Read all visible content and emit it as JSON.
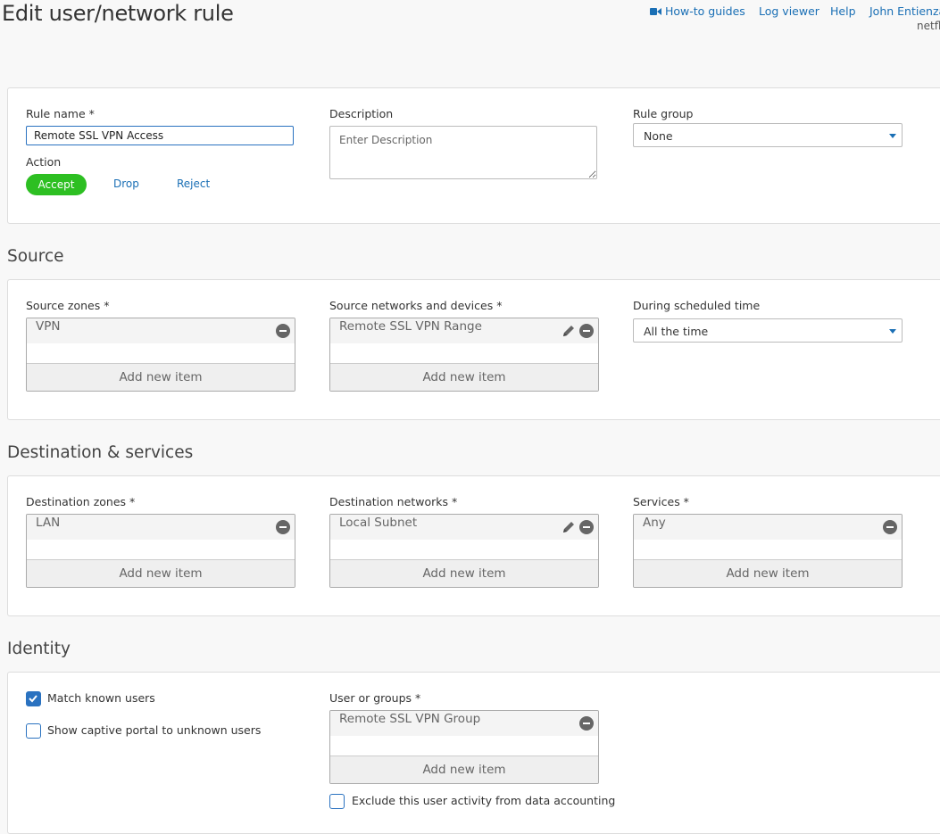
{
  "page": {
    "title": "Edit user/network rule"
  },
  "header": {
    "links": [
      "How-to guides",
      "Log viewer",
      "Help",
      "John Entienza"
    ],
    "org": "netfl"
  },
  "rule": {
    "name_label": "Rule name *",
    "name_value": "Remote SSL VPN Access",
    "description_label": "Description",
    "description_placeholder": "Enter Description",
    "group_label": "Rule group",
    "group_value": "None",
    "action_label": "Action",
    "actions": [
      "Accept",
      "Drop",
      "Reject"
    ],
    "selected_action": "Accept"
  },
  "source": {
    "heading": "Source",
    "zones_label": "Source zones *",
    "zones": [
      "VPN"
    ],
    "networks_label": "Source networks and devices *",
    "networks": [
      "Remote SSL VPN Range"
    ],
    "schedule_label": "During scheduled time",
    "schedule_value": "All the time"
  },
  "destination": {
    "heading": "Destination & services",
    "zones_label": "Destination zones *",
    "zones": [
      "LAN"
    ],
    "networks_label": "Destination networks *",
    "networks": [
      "Local Subnet"
    ],
    "services_label": "Services *",
    "services": [
      "Any"
    ]
  },
  "identity": {
    "heading": "Identity",
    "match_known_users": "Match known users",
    "match_known_users_checked": true,
    "captive_portal": "Show captive portal to unknown users",
    "captive_portal_checked": false,
    "users_label": "User or groups *",
    "users": [
      "Remote SSL VPN Group"
    ],
    "exclude_accounting": "Exclude this user activity from data accounting",
    "exclude_accounting_checked": false
  },
  "common": {
    "add_new_item": "Add new item"
  },
  "colors": {
    "accent": "#1a6fb5",
    "accept": "#2dbf22",
    "checkbox": "#2a72c0"
  }
}
